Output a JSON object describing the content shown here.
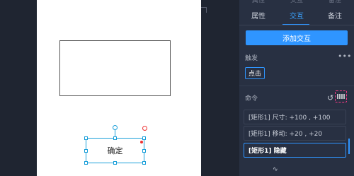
{
  "panel": {
    "tabs_ghost": [
      "属性",
      "交互",
      "备注"
    ],
    "tabs": [
      {
        "label": "属性",
        "active": false
      },
      {
        "label": "交互",
        "active": true
      },
      {
        "label": "备注",
        "active": false
      }
    ],
    "add_interaction_label": "添加交互",
    "trigger_section_label": "触发",
    "trigger_more_icon": "more-icon",
    "trigger_button_label": "点击",
    "command_section_label": "命令",
    "undo_icon": "undo-icon",
    "reorder_icon": "reorder-icon",
    "commands": [
      {
        "label": "[矩形1] 尺寸: +100 , +100",
        "selected": false
      },
      {
        "label": "[矩形1] 移动: +20 , +20",
        "selected": false
      },
      {
        "label": "[矩形1] 隐藏",
        "selected": true
      }
    ],
    "bottom_icon": "resize-icon"
  },
  "canvas": {
    "button_label": "确定"
  },
  "colors": {
    "accent": "#2f95ff",
    "panel_bg": "#283042",
    "selection": "#1a9fd9",
    "highlight_dashed": "#ff3b8a"
  }
}
